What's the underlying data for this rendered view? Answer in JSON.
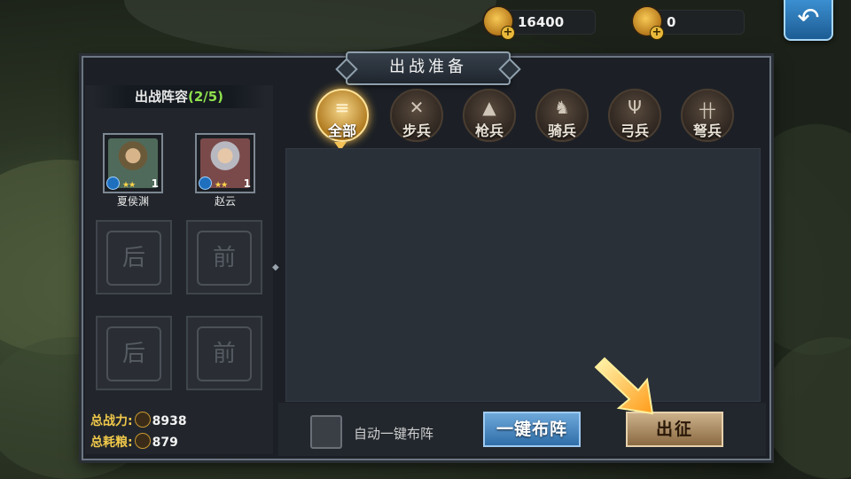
{
  "resources": {
    "food": {
      "value": "16400",
      "icon": "food-coin-icon"
    },
    "gold": {
      "value": "0",
      "icon": "gold-ingot-icon"
    }
  },
  "back_icon": "↶",
  "title": "出战准备",
  "roster": {
    "label": "出战阵容",
    "count": "(2/5)",
    "heroes": [
      {
        "name": "夏侯渊",
        "level": "1",
        "stars": "★★",
        "color": "#6b7b6e"
      },
      {
        "name": "赵云",
        "level": "1",
        "stars": "★★",
        "color": "#7b6f70"
      }
    ],
    "empty_slots": [
      "后",
      "前",
      "后",
      "前"
    ]
  },
  "stats": {
    "power_label": "总战力:",
    "power_value": "8938",
    "grain_label": "总耗粮:",
    "grain_value": "879"
  },
  "tabs": [
    {
      "label": "全部",
      "glyph": "≡",
      "active": true
    },
    {
      "label": "步兵",
      "glyph": "✕",
      "active": false
    },
    {
      "label": "枪兵",
      "glyph": "▲",
      "active": false
    },
    {
      "label": "骑兵",
      "glyph": "♞",
      "active": false
    },
    {
      "label": "弓兵",
      "glyph": "Ψ",
      "active": false
    },
    {
      "label": "弩兵",
      "glyph": "卄",
      "active": false
    }
  ],
  "controls": {
    "auto_label": "自动一键布阵",
    "one_click_label": "一键布阵",
    "go_label": "出征"
  },
  "colors": {
    "accent_gold": "#f0c84a",
    "button_blue": "#2f6ea9",
    "active_tab": "#b07a1f"
  }
}
